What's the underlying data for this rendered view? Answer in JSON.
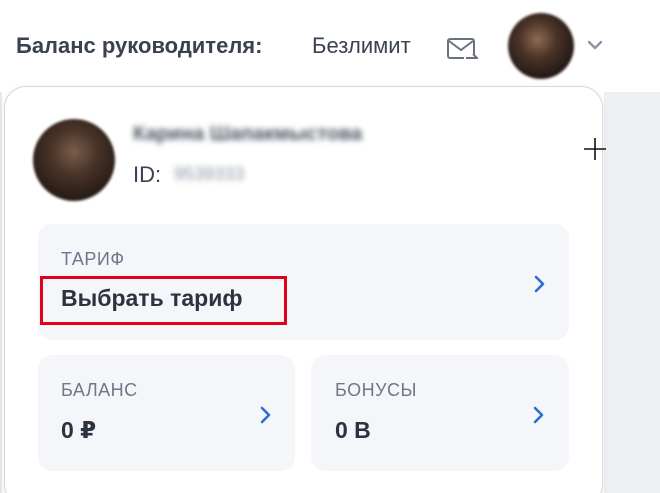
{
  "header": {
    "balance_label": "Баланс руководителя:",
    "balance_value": "Безлимит",
    "mail_icon": "mail-envelope-icon",
    "avatar_icon": "user-avatar",
    "chevron_icon": "chevron-down-icon"
  },
  "profile": {
    "name": "Карина Шапакмыстова",
    "id_label": "ID:",
    "id_value": "9539333"
  },
  "cards": {
    "tariff": {
      "caption": "ТАРИФ",
      "value": "Выбрать тариф"
    },
    "balance": {
      "caption": "БАЛАНС",
      "value": "0 ₽"
    },
    "bonus": {
      "caption": "БОНУСЫ",
      "value": "0 В"
    }
  },
  "colors": {
    "accent_chevron": "#2b6fd6",
    "highlight": "#e0001b",
    "card_bg": "#f4f6fa"
  }
}
